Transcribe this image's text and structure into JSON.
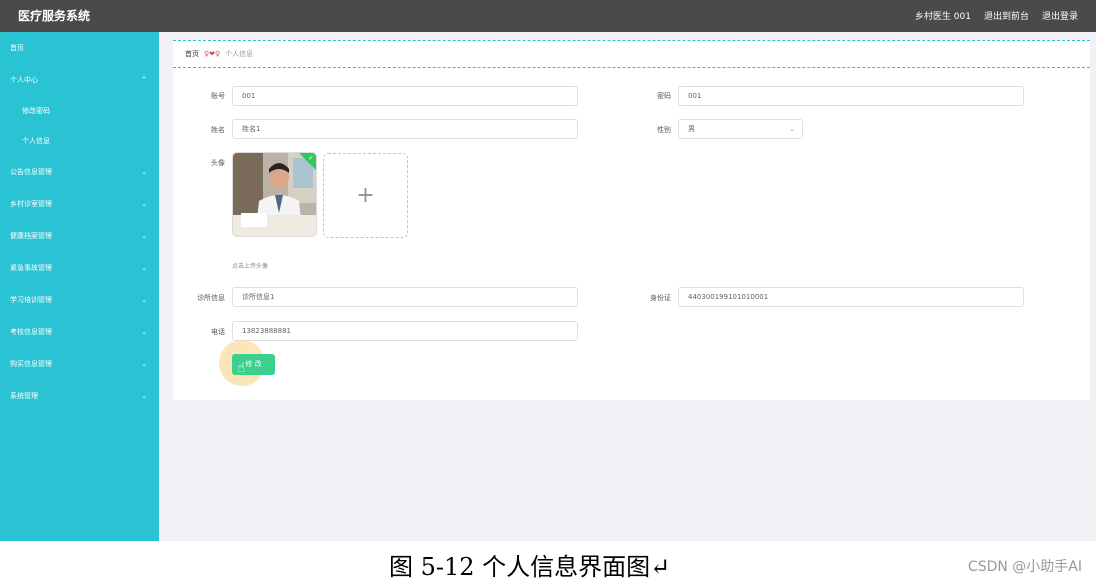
{
  "app": {
    "title": "医疗服务系统"
  },
  "header": {
    "user": "乡村医生 001",
    "front_link": "退出到前台",
    "logout_link": "退出登录"
  },
  "sidebar": {
    "items": [
      {
        "label": "首页",
        "chevron": ""
      },
      {
        "label": "个人中心",
        "chevron": "^"
      },
      {
        "label": "修改密码",
        "sub": true
      },
      {
        "label": "个人信息",
        "sub": true
      },
      {
        "label": "公告信息管理",
        "chevron": "⌄"
      },
      {
        "label": "乡村诊室管理",
        "chevron": "⌄"
      },
      {
        "label": "健康档案管理",
        "chevron": "⌄"
      },
      {
        "label": "紧急事故管理",
        "chevron": "⌄"
      },
      {
        "label": "学习培训管理",
        "chevron": "⌄"
      },
      {
        "label": "考核信息管理",
        "chevron": "⌄"
      },
      {
        "label": "购买信息管理",
        "chevron": "⌄"
      },
      {
        "label": "系统管理",
        "chevron": "⌄"
      }
    ]
  },
  "breadcrumb": {
    "home": "首页",
    "separator": "♀❤♀",
    "current": "个人信息"
  },
  "form": {
    "account_label": "账号",
    "account_value": "001",
    "password_label": "密码",
    "password_value": "001",
    "name_label": "姓名",
    "name_value": "姓名1",
    "gender_label": "性别",
    "gender_value": "男",
    "avatar_label": "头像",
    "avatar_hint": "点击上传头像",
    "clinic_label": "诊所信息",
    "clinic_value": "诊所信息1",
    "idcard_label": "身份证",
    "idcard_value": "440300199101010001",
    "phone_label": "电话",
    "phone_value": "13823888881",
    "submit_label": "修 改"
  },
  "caption": {
    "text": "图 5-12 个人信息界面图↵",
    "watermark": "CSDN @小助手AI"
  }
}
